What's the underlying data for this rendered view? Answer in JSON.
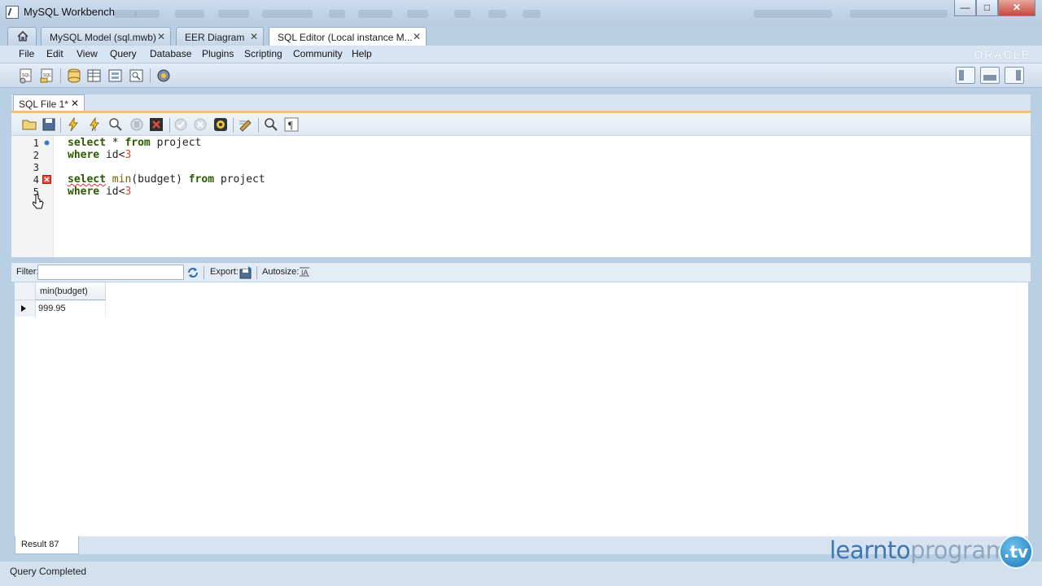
{
  "window": {
    "title": "MySQL Workbench"
  },
  "tabs": [
    {
      "label": "MySQL Model (sql.mwb)"
    },
    {
      "label": "EER Diagram"
    },
    {
      "label": "SQL Editor (Local instance M..."
    }
  ],
  "menu": [
    "File",
    "Edit",
    "View",
    "Query",
    "Database",
    "Plugins",
    "Scripting",
    "Community",
    "Help"
  ],
  "brand": {
    "oracle": "ORACLE"
  },
  "editor": {
    "file_tab": "SQL File 1*",
    "lines": [
      {
        "n": "1",
        "marker": "dot"
      },
      {
        "n": "2",
        "marker": ""
      },
      {
        "n": "3",
        "marker": ""
      },
      {
        "n": "4",
        "marker": "error"
      },
      {
        "n": "5",
        "marker": ""
      }
    ],
    "code": {
      "l1_select": "select",
      "l1_star": " * ",
      "l1_from": "from",
      "l1_table": " project",
      "l2_where": "where",
      "l2_cond": " id<",
      "l2_num": "3",
      "l4_select": "select",
      "l4_min": "min",
      "l4_args": "(budget) ",
      "l4_from": "from",
      "l4_table": " project",
      "l5_where": "where",
      "l5_cond": " id<",
      "l5_num": "3"
    }
  },
  "result": {
    "filter_label": "Filter:",
    "filter_value": "",
    "export_label": "Export:",
    "autosize_label": "Autosize:",
    "columns": [
      "min(budget)"
    ],
    "rows": [
      [
        "999.95"
      ]
    ],
    "tab": "Result 87"
  },
  "status": {
    "text": "Query Completed"
  },
  "watermark": {
    "part1": "learnto",
    "part2": "program",
    "badge": ".tv"
  },
  "colors": {
    "accent_orange": "#f0c478",
    "frame_blue": "#b9cfe4"
  }
}
